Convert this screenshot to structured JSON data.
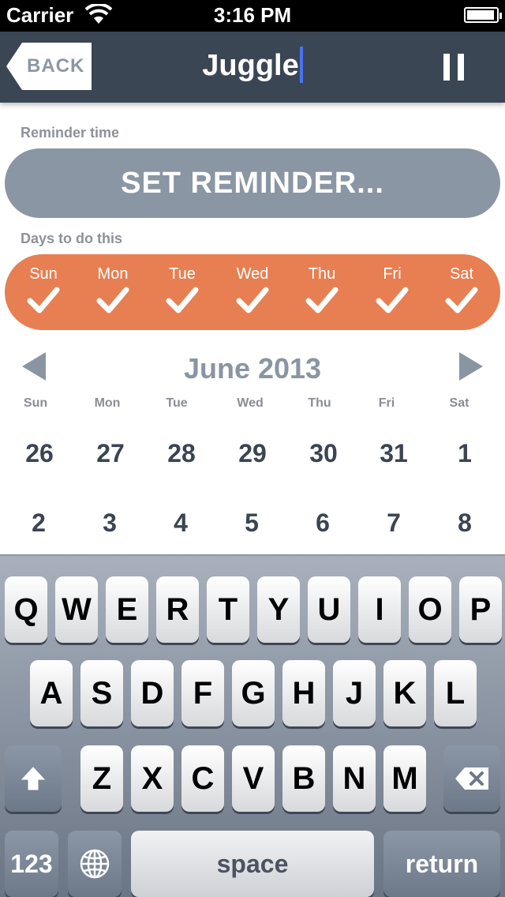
{
  "status_bar": {
    "carrier": "Carrier",
    "time": "3:16 PM"
  },
  "nav": {
    "back_label": "BACK",
    "title": "Juggle"
  },
  "reminder": {
    "label": "Reminder time",
    "button": "SET REMINDER..."
  },
  "days": {
    "label": "Days to do this",
    "color": "#e77f52",
    "items": [
      "Sun",
      "Mon",
      "Tue",
      "Wed",
      "Thu",
      "Fri",
      "Sat"
    ]
  },
  "calendar": {
    "title": "June 2013",
    "weekdays": [
      "Sun",
      "Mon",
      "Tue",
      "Wed",
      "Thu",
      "Fri",
      "Sat"
    ],
    "rows": [
      [
        "26",
        "27",
        "28",
        "29",
        "30",
        "31",
        "1"
      ],
      [
        "2",
        "3",
        "4",
        "5",
        "6",
        "7",
        "8"
      ]
    ]
  },
  "keyboard": {
    "row1": [
      "Q",
      "W",
      "E",
      "R",
      "T",
      "Y",
      "U",
      "I",
      "O",
      "P"
    ],
    "row2": [
      "A",
      "S",
      "D",
      "F",
      "G",
      "H",
      "J",
      "K",
      "L"
    ],
    "row3": [
      "Z",
      "X",
      "C",
      "V",
      "B",
      "N",
      "M"
    ],
    "numbers_label": "123",
    "space_label": "space",
    "return_label": "return"
  }
}
